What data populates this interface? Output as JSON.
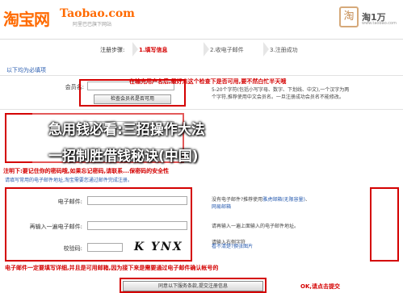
{
  "header": {
    "logo_cn": "淘宝网",
    "logo_url": "Taobao.com",
    "logo_sub": "阿里巴巴旗下网站",
    "right_seal": "淘",
    "right_brand": "淘1万",
    "right_url": "www.taobao.com"
  },
  "steps": {
    "caption": "注册步骤:",
    "step1": "1.填写信息",
    "step2": "2.收电子邮件",
    "step3": "3.注册成功"
  },
  "form": {
    "required_note": "以下均为必填项",
    "required_link": "",
    "member_name_label": "会员名:",
    "check_name_button": "检查会员名是否可用",
    "member_name_tip_1": "5-20个字符(包括小写字母、数字、下划线、中文),一个汉字为两",
    "member_name_tip_2": "个字符,推荐使用中文会员名。一旦注册成功会员名不能修改。",
    "reenter_password_label": "再输入",
    "email_label": "电子邮件:",
    "email_tip_1": "没有电子邮件?推荐使用",
    "email_tip_link": "雅虎邮箱(无限容量)",
    "email_tip_2": "、",
    "email_tip_link2": "网易邮箱",
    "reenter_email_label": "再输入一遍电子邮件:",
    "reenter_email_tip": "请再输入一遍上面输入的电子邮件地址。",
    "captcha_label": "校验码:",
    "captcha_text": "K YNX",
    "captcha_tip": "请输入右侧字符",
    "change_pic": "看不清楚?换张图片",
    "submit_button": "同意以下服务条款,提交注册信息"
  },
  "annotations": {
    "name_note": "在输完用户名后,最好点这个检查下是否可用,要不然白忙半天哦",
    "overlay_line1": "急用钱必看:三招操作大法",
    "overlay_line2": "一招制胜借钱秘诀(中国)",
    "password_note": "注明下:要记住你的密码哦,如果忘记密码,请联系...保密码的安全性",
    "email_prompt": "请填写常用的电子邮件地址,淘宝需要您通过邮件完成注册。",
    "bottom_note": "电子邮件一定要填写详细,并且是可用邮箱,因为接下来是需要通过电子邮件确认帐号的",
    "ok_note": "OK,请点击提交"
  },
  "colors": {
    "brand_orange": "#ff6a00",
    "annotation_red": "#d40000",
    "link_blue": "#2a5db0"
  }
}
